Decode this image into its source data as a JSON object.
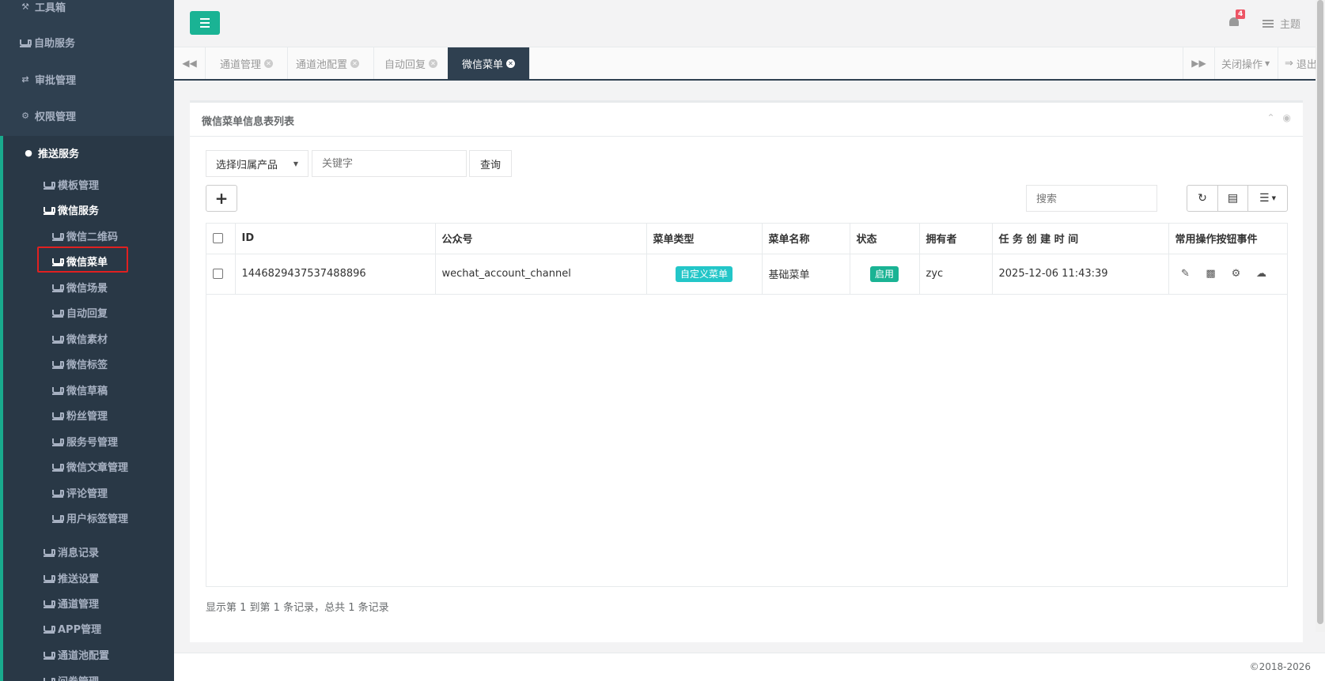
{
  "sidebar": {
    "top_items": [
      {
        "label": "工具箱",
        "icon": "wrench-icon"
      },
      {
        "label": "自助服务",
        "icon": "coffee-icon"
      },
      {
        "label": "审批管理",
        "icon": "exchange-icon"
      },
      {
        "label": "权限管理",
        "icon": "gear-icon"
      }
    ],
    "push": {
      "label": "推送服务",
      "icon": "comment-icon"
    },
    "push_children": [
      {
        "label": "模板管理"
      },
      {
        "label": "微信服务"
      },
      {
        "label": "消息记录"
      },
      {
        "label": "推送设置"
      },
      {
        "label": "通道管理"
      },
      {
        "label": "APP管理"
      },
      {
        "label": "通道池配置"
      },
      {
        "label": "问卷管理"
      }
    ],
    "wechat_children": [
      {
        "label": "微信二维码"
      },
      {
        "label": "微信菜单"
      },
      {
        "label": "微信场景"
      },
      {
        "label": "自动回复"
      },
      {
        "label": "微信素材"
      },
      {
        "label": "微信标签"
      },
      {
        "label": "微信草稿"
      },
      {
        "label": "粉丝管理"
      },
      {
        "label": "服务号管理"
      },
      {
        "label": "微信文章管理"
      },
      {
        "label": "评论管理"
      },
      {
        "label": "用户标签管理"
      }
    ]
  },
  "topbar": {
    "notification_count": "4",
    "theme_label": "主题"
  },
  "tabs": {
    "items": [
      {
        "label": "通道管理",
        "active": false
      },
      {
        "label": "通道池配置",
        "active": false
      },
      {
        "label": "自动回复",
        "active": false
      },
      {
        "label": "微信菜单",
        "active": true
      }
    ],
    "close_ops_label": "关闭操作",
    "logout_label": "退出"
  },
  "panel": {
    "title": "微信菜单信息表列表",
    "product_select": "选择归属产品",
    "keyword_placeholder": "关键字",
    "query_label": "查询",
    "search_placeholder": "搜索"
  },
  "table": {
    "columns": [
      "ID",
      "公众号",
      "菜单类型",
      "菜单名称",
      "状态",
      "拥有者",
      "任 务 创 建 时 间",
      "常用操作按钮事件"
    ],
    "rows": [
      {
        "id": "1446829437537488896",
        "account": "wechat_account_channel",
        "menu_type": "自定义菜单",
        "menu_name": "基础菜单",
        "status": "启用",
        "owner": "zyc",
        "created": "2025-12-06 11:43:39"
      }
    ]
  },
  "pager_info": "显示第 1 到第 1 条记录，总共 1 条记录",
  "footer": "©2018-2026",
  "colors": {
    "sidebar_bg": "#2f4050",
    "accent": "#1ab394",
    "info": "#23c6c8",
    "badge_red": "#ed5565"
  }
}
